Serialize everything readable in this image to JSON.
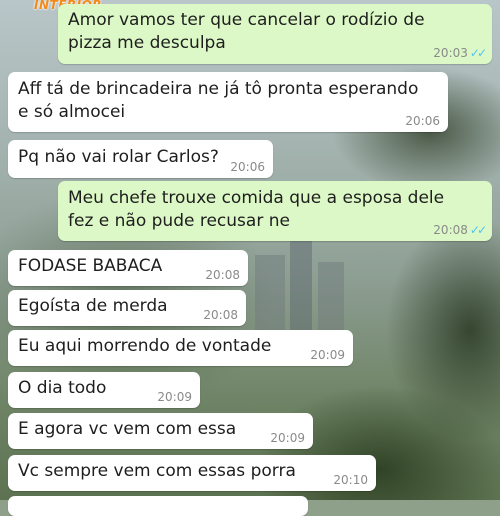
{
  "watermark": "INTERIOR",
  "messages": [
    {
      "dir": "out",
      "text_l1": "Amor vamos ter que cancelar o rodízio de",
      "text_l2": "pizza me desculpa",
      "time": "20:03",
      "read": "✓✓"
    },
    {
      "dir": "in",
      "text_l1": "Aff tá de brincadeira ne já tô pronta esperando",
      "text_l2": "e só almocei",
      "time": "20:06"
    },
    {
      "dir": "in",
      "text": "Pq não vai rolar Carlos?",
      "time": "20:06"
    },
    {
      "dir": "out",
      "text_l1": "Meu chefe trouxe comida que a esposa dele",
      "text_l2": "fez e não pude recusar ne",
      "time": "20:08",
      "read": "✓✓"
    },
    {
      "dir": "in",
      "text": "FODASE BABACA",
      "time": "20:08"
    },
    {
      "dir": "in",
      "text": "Egoísta de merda",
      "time": "20:08"
    },
    {
      "dir": "in",
      "text": "Eu aqui morrendo de vontade",
      "time": "20:09"
    },
    {
      "dir": "in",
      "text": "O dia todo",
      "time": "20:09"
    },
    {
      "dir": "in",
      "text": "E agora vc vem com essa",
      "time": "20:09"
    },
    {
      "dir": "in",
      "text": "Vc sempre vem com essas porra",
      "time": "20:10"
    }
  ]
}
